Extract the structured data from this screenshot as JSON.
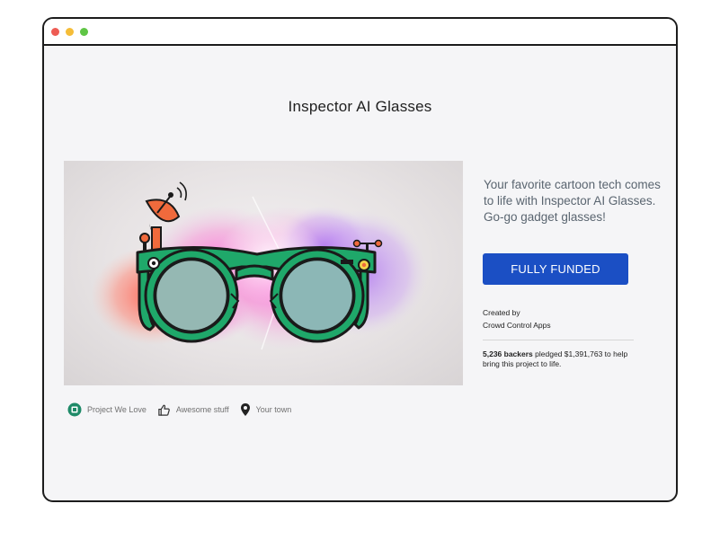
{
  "window": {
    "buttons": [
      "close",
      "minimize",
      "maximize"
    ]
  },
  "project": {
    "title": "Inspector AI Glasses",
    "description": "Your favorite cartoon tech comes to life with Inspector AI Glasses. Go-go gadget glasses!",
    "status_button": "FULLY FUNDED",
    "created_by_label": "Created by",
    "creator": "Crowd Control Apps",
    "backers": "5,236 backers",
    "pledge_text": "pledged $1,391,763 to help bring this project to life."
  },
  "meta": [
    {
      "label": "Project We Love",
      "icon": "project-we-love-icon"
    },
    {
      "label": "Awesome stuff",
      "icon": "thumbs-up-icon"
    },
    {
      "label": "Your town",
      "icon": "location-pin-icon"
    }
  ],
  "colors": {
    "accent": "#1b4fc4",
    "glasses": "#1fa86a",
    "badge": "#1e8a68"
  }
}
